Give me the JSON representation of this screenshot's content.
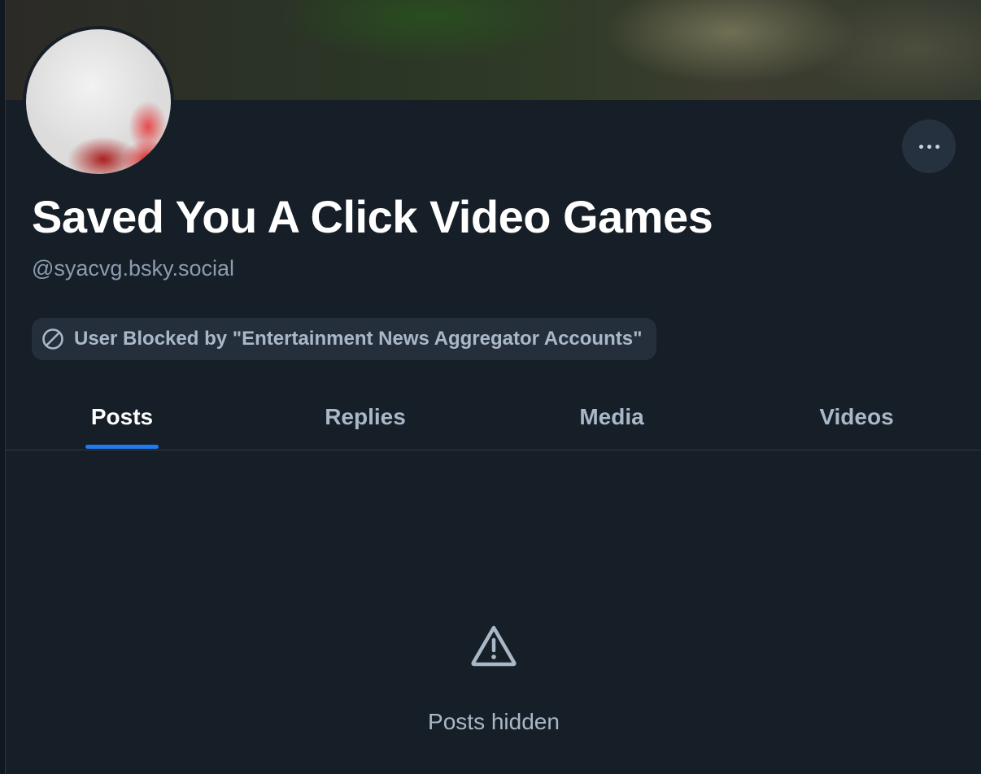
{
  "profile": {
    "display_name": "Saved You A Click Video Games",
    "handle": "@syacvg.bsky.social",
    "label": "User Blocked by \"Entertainment News Aggregator Accounts\"",
    "label_icon": "block-icon",
    "more_icon": "ellipsis-icon"
  },
  "tabs": [
    {
      "label": "Posts",
      "active": true
    },
    {
      "label": "Replies",
      "active": false
    },
    {
      "label": "Media",
      "active": false
    },
    {
      "label": "Videos",
      "active": false
    }
  ],
  "content": {
    "status_icon": "warning-icon",
    "status_text": "Posts hidden"
  },
  "colors": {
    "background": "#161e27",
    "accent": "#1e7bf0",
    "muted_text": "#a9b8c8"
  }
}
